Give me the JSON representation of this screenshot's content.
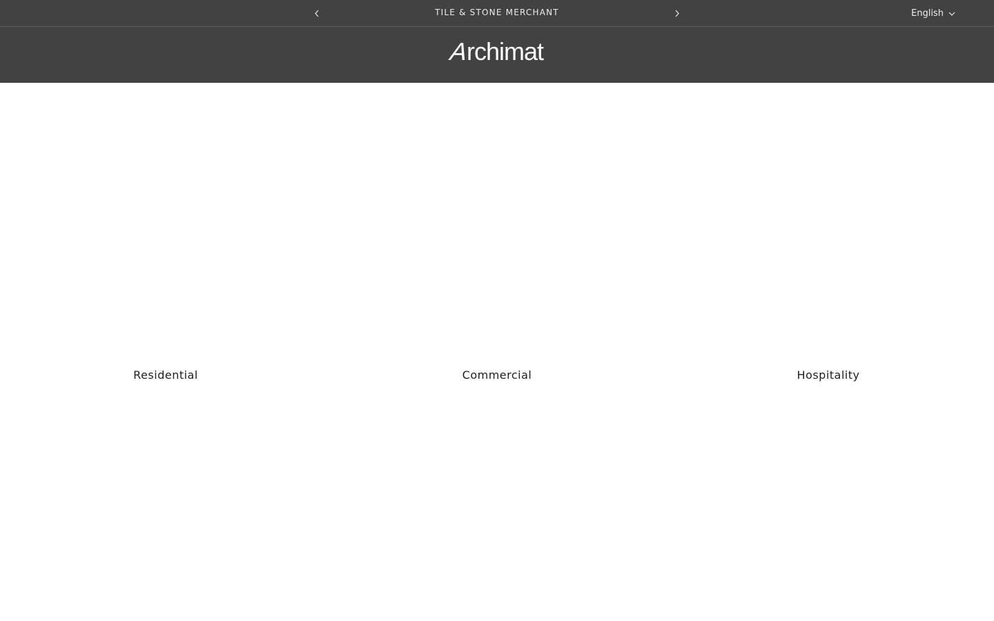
{
  "announcement": {
    "text": "TILE & STONE MERCHANT",
    "prev_icon": "chevron-left-icon",
    "next_icon": "chevron-right-icon"
  },
  "language": {
    "selected": "English",
    "icon": "chevron-down-icon"
  },
  "header": {
    "logo_text": "Archimat"
  },
  "collections": [
    {
      "label": "Residential"
    },
    {
      "label": "Commercial"
    },
    {
      "label": "Hospitality"
    }
  ],
  "colors": {
    "header_bg": "#424242",
    "header_text": "#ececec",
    "page_bg": "#ffffff",
    "body_text": "#1e1e1e"
  }
}
